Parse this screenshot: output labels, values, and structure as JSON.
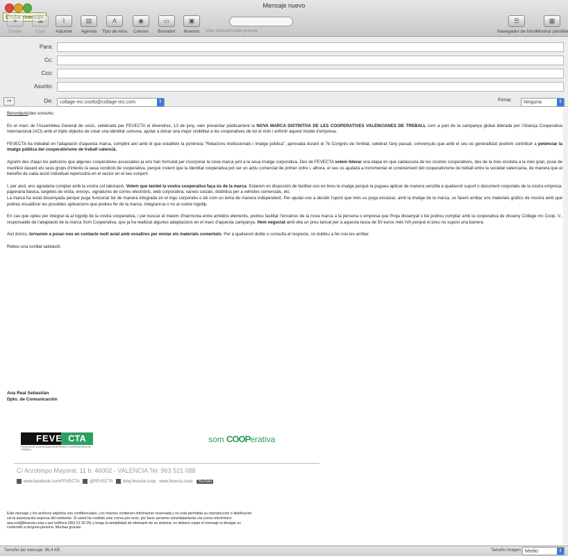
{
  "window": {
    "title": "Mensaje nuevo",
    "tooltip": "Enviar mensaje"
  },
  "toolbar": {
    "buttons": [
      {
        "label": "Enviar",
        "icon": "send-icon",
        "enabled": false
      },
      {
        "label": "Chat",
        "icon": "chat-icon",
        "enabled": false
      },
      {
        "label": "Adjuntar",
        "icon": "paperclip-icon",
        "enabled": true
      },
      {
        "label": "Agenda",
        "icon": "address-book-icon",
        "enabled": true
      },
      {
        "label": "Tipo de letra",
        "icon": "font-icon",
        "enabled": true
      },
      {
        "label": "Colores",
        "icon": "color-wheel-icon",
        "enabled": true
      },
      {
        "label": "Borrador",
        "icon": "save-draft-icon",
        "enabled": true
      },
      {
        "label": "Nuestro",
        "icon": "photo-icon",
        "enabled": true
      },
      {
        "label": "Más pequeño",
        "icon": "smaller-icon",
        "enabled": false
      },
      {
        "label": "Más grande",
        "icon": "bigger-icon",
        "enabled": false
      }
    ],
    "right_buttons": [
      {
        "label": "Navegador de fotos",
        "icon": "photo-browser-icon"
      },
      {
        "label": "Mostrar plantillas",
        "icon": "templates-icon"
      }
    ]
  },
  "header": {
    "para_label": "Para:",
    "cc_label": "Cc:",
    "cco_label": "Cco:",
    "asunto_label": "Asunto:",
    "de_label": "De:",
    "de_value": "collage-mc.coofo@collage-mc.com",
    "firma_label": "Firma:",
    "firma_value": "Ninguna"
  },
  "body": {
    "greeting_link": "Benvolguts",
    "greeting_rest": "/des socis/es:",
    "p1_a": "En el marc de l'Assemblea General de socis, celebrada per FEVECTA el divendres, 13 de juny, vam presentar públicament la ",
    "p1_b": "NOVA MARCA DISTINTIVA DE LES COOPERATIVES VALENCIANES DE TREBALL",
    "p1_c": " com a part de la campanya global liderada per l'Aliança Cooperativa Internacional (ACI) amb el triple objectiu de crear una identitat comuna, ajudar a donar una major visibilitat a les cooperatives de tot el món i enfortir aquest model d'empresa.",
    "p2_a": "FEVECTA ha treballat en l'adaptació d'aquesta marca, complint així amb el que estableix la ponència \"Relacions institucionals i imatge pública\", aprovada durant el 7è Congrés de l'entitat, celebrat l'any passat, convençuts que amb el seu ús generalitzat podrem contribuir a ",
    "p2_b": "potenciar la imatge pública del cooperativisme de treball valencià.",
    "p3_a": "Agraïm des d'aquí les peticions que algunes cooperatives associades ja ens han formulat per incorporar la nova marca junt a la seua imatge corporativa. Des de FEVECTA ",
    "p3_b": "volem liderar",
    "p3_c": " una etapa en què cadascuna de les nostres cooperatives, des de la més xicoteta a la més gran, puse de manifest davant els seus grups d'interès la seua condició de cooperativa, perquè creiem que la identitat cooperativa pot ser un actiu comercial de primer ordre i, alhora, el seu ús ajudarà a incrementar el coneixement del cooperativisme de treball entre la societat valenciana, de manera que el benefici de cada acció individual repercutirà en el sector en el seu conjunt.",
    "p4_a": "I, per això, ens agradaria comptar amb la vostra col·laboració. ",
    "p4_b": "Volem que també la vostra cooperativa faça ús de la marca",
    "p4_c": ". Estarem en disposició de facilitar-vos en breu la imatge perquè la pugueu aplicar de manera senzilla a qualsevol suport o document corporatiu de la vostra empresa: paperaria bàsica, targetes de visita, envoys, signatures de correu electrònic, web corporativa, xarxes socials, distintius per a vehicles comercials, etc.",
    "p4_d": "La marca ha estat dissenyada perquè puga funcionar bé de manera integrada en el logo corporatiu o bé com un lema de manera independent. Per ajudar-vos a decidir l'opció que més us puga encaixar, amb la imatge de la marca, us farem arribar uns materials gràfics de mostra amb què podreu visualitzar les possibles aplicacions que podreu fer de la marca, integrant-la o no al vostre logotip.",
    "p5_a": "En cas que opteu per integrar-la al logotip de la vostra cooperativa, i per buscar el màxim d'harmonia entre ambdós elements, podreu facilitar l'encàrrec de la nova marca a la persona o empresa que l'hoja dissenyat o bé podreu comptar amb la cooperativa de disseny Collage mc Coop. V., responsable de l'adaptació de la marca Som Cooperativa, que ja ha realitzat algunes adaptacions en el marc d'aquesta campanya. ",
    "p5_b": "Hem negociat",
    "p5_c": " amb ella un preu tancat per a aquesta tasca de 50 euros més IVA perquè el preu no suposi una barrera.",
    "p6_a": "Així doncs, ",
    "p6_b": "tornarem a posar-nos en contacte molt aviat amb vosaltres per enviar els materials comentats",
    "p6_c": ". Per a qualsevol dubte o consulta al respecte, no dubteu a fer-nos-les arribar.",
    "closing": "Rebeu una cordial salutació.",
    "sig_name": "Ana Real Sebastián",
    "sig_dept": "Dpto. de Comunicación"
  },
  "footer": {
    "logo_left_a": "FEVE",
    "logo_left_b": "CTA",
    "logo_left_sub": "FEDERACIÓ VALENCIANA D'EMPRESES COOPERATIVES DE TREBALL",
    "logo_right_a": "som ",
    "logo_right_b": "COOP",
    "logo_right_c": "erativa",
    "address": "C/ Arzobispo Mayoral, 11 b. 46002 - VALENCIA  Tel. 963 521 088",
    "social_fb": "www.facebook.com/FEVECTA",
    "social_tw": "@FEVECTA",
    "social_blog": "blog.fevecta.coop",
    "social_web": "www.fevecta.coop",
    "social_yt": "YouTube",
    "legal": "Este mensaje y los archivos adjuntos son confidenciales. Los mismos contienen información reservada y no está permitida su reproducción o distribución sin la autorización expresa del remitente. Si usted ha recibido este correo por error, por favor avíseme inmediatamente vía correo electrónico ana.real@fevecta.coop o por teléfono (963 51 00 29) y tenga la amabilidad de eliminarlo de su sistema; no deberá copiar el mensaje ni divulgar su contenido a ninguna persona. Muchas gracias."
  },
  "status": {
    "size_text": "Tamaño del mensaje: 95,4 KB",
    "image_label": "Tamaño imagen:",
    "image_value": "Medio"
  }
}
